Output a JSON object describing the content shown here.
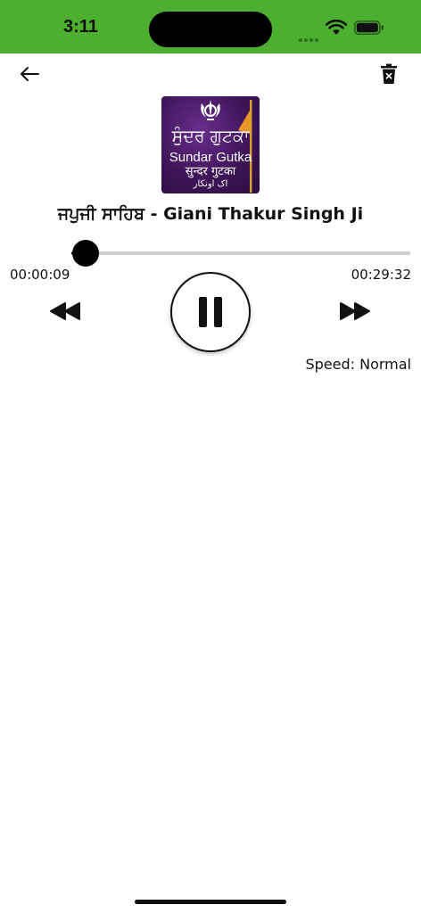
{
  "status_bar": {
    "time": "3:11",
    "background_color": "#4caf2f"
  },
  "header": {
    "back_icon": "arrow-left-icon",
    "delete_icon": "trash-x-icon"
  },
  "artwork": {
    "line1": "ਸੁੰਦਰ ਗੁਟਕਾ",
    "line2": "Sundar Gutka",
    "line3": "सुन्दर गुटका",
    "line4": "اک اونکار",
    "background_color": "#3f1559"
  },
  "player": {
    "title": "ਜਪੁਜੀ ਸਾਹਿਬ - Giani Thakur Singh Ji",
    "elapsed": "00:00:09",
    "duration": "00:29:32",
    "progress_fraction": 0.005,
    "speed_label": "Speed: Normal",
    "state": "playing",
    "rewind_icon": "rewind-icon",
    "forward_icon": "fast-forward-icon",
    "pause_icon": "pause-icon"
  }
}
